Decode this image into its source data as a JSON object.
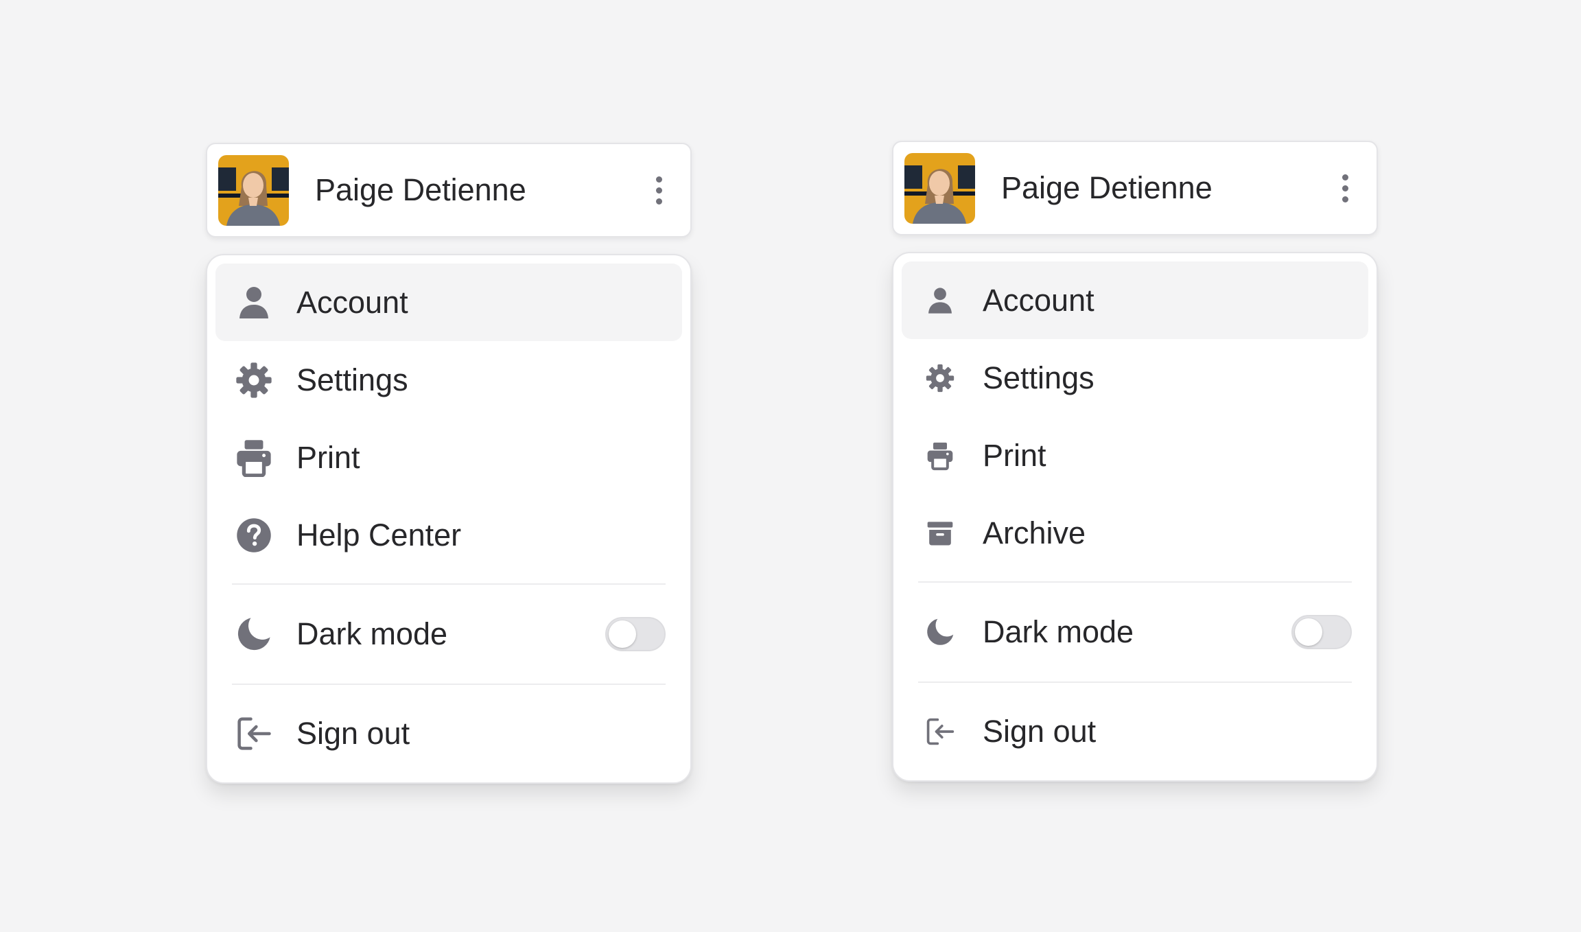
{
  "colors": {
    "background": "#f4f4f5",
    "icon": "#71717a",
    "text": "#27272a",
    "active_item_bg": "#f4f4f5",
    "toggle_track": "#e4e4e7"
  },
  "variants": [
    {
      "user": {
        "name": "Paige Detienne",
        "avatar": "user-photo-avatar"
      },
      "menu": {
        "items": [
          {
            "label": "Account",
            "icon": "user-icon",
            "active": true
          },
          {
            "label": "Settings",
            "icon": "gear-icon"
          },
          {
            "label": "Print",
            "icon": "printer-icon"
          },
          {
            "label": "Help Center",
            "icon": "help-circle-icon"
          }
        ],
        "dark_mode": {
          "label": "Dark mode",
          "icon": "moon-icon",
          "enabled": false
        },
        "sign_out": {
          "label": "Sign out",
          "icon": "sign-out-icon"
        }
      }
    },
    {
      "user": {
        "name": "Paige Detienne",
        "avatar": "user-photo-avatar"
      },
      "menu": {
        "items": [
          {
            "label": "Account",
            "icon": "user-icon",
            "active": true
          },
          {
            "label": "Settings",
            "icon": "gear-icon"
          },
          {
            "label": "Print",
            "icon": "printer-icon"
          },
          {
            "label": "Archive",
            "icon": "archive-icon"
          }
        ],
        "dark_mode": {
          "label": "Dark mode",
          "icon": "moon-icon",
          "enabled": false
        },
        "sign_out": {
          "label": "Sign out",
          "icon": "sign-out-icon"
        }
      }
    }
  ]
}
